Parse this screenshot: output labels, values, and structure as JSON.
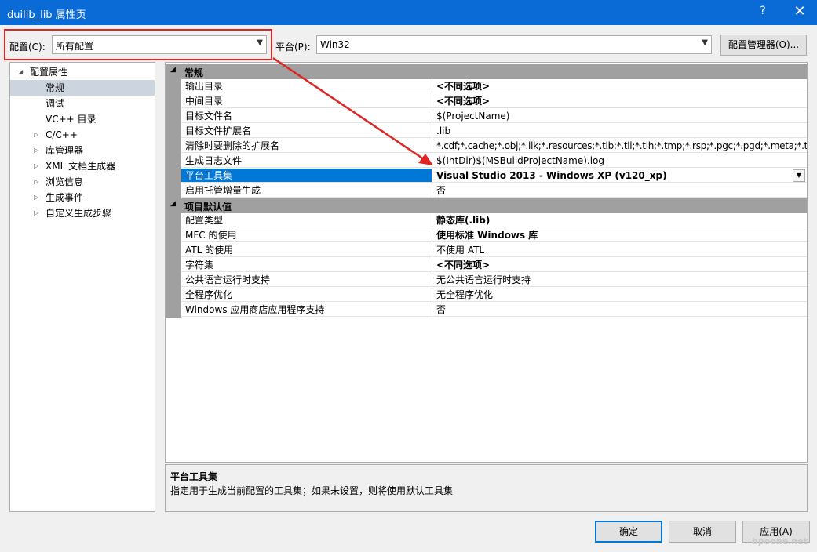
{
  "window": {
    "title": "duilib_lib 属性页",
    "help": "?",
    "close": "✕"
  },
  "config_bar": {
    "config_label": "配置(C):",
    "config_value": "所有配置",
    "platform_label": "平台(P):",
    "platform_value": "Win32",
    "manager_button": "配置管理器(O)..."
  },
  "tree": {
    "root": "配置属性",
    "items": [
      {
        "label": "常规",
        "selected": true
      },
      {
        "label": "调试"
      },
      {
        "label": "VC++ 目录"
      },
      {
        "label": "C/C++",
        "expandable": true
      },
      {
        "label": "库管理器",
        "expandable": true
      },
      {
        "label": "XML 文档生成器",
        "expandable": true
      },
      {
        "label": "浏览信息",
        "expandable": true
      },
      {
        "label": "生成事件",
        "expandable": true
      },
      {
        "label": "自定义生成步骤",
        "expandable": true
      }
    ]
  },
  "grid": {
    "cat1": "常规",
    "general": [
      {
        "name": "输出目录",
        "value": "<不同选项>"
      },
      {
        "name": "中间目录",
        "value": "<不同选项>"
      },
      {
        "name": "目标文件名",
        "value": "$(ProjectName)"
      },
      {
        "name": "目标文件扩展名",
        "value": ".lib"
      },
      {
        "name": "清除时要删除的扩展名",
        "value": "*.cdf;*.cache;*.obj;*.ilk;*.resources;*.tlb;*.tli;*.tlh;*.tmp;*.rsp;*.pgc;*.pgd;*.meta;*.tlog;"
      },
      {
        "name": "生成日志文件",
        "value": "$(IntDir)$(MSBuildProjectName).log"
      },
      {
        "name": "平台工具集",
        "value": "Visual Studio 2013 - Windows XP (v120_xp)"
      },
      {
        "name": "启用托管增量生成",
        "value": "否"
      }
    ],
    "cat2": "项目默认值",
    "defaults": [
      {
        "name": "配置类型",
        "value": "静态库(.lib)"
      },
      {
        "name": "MFC 的使用",
        "value": "使用标准 Windows 库"
      },
      {
        "name": "ATL 的使用",
        "value": "不使用 ATL"
      },
      {
        "name": "字符集",
        "value": "<不同选项>"
      },
      {
        "name": "公共语言运行时支持",
        "value": "无公共语言运行时支持"
      },
      {
        "name": "全程序优化",
        "value": "无全程序优化"
      },
      {
        "name": "Windows 应用商店应用程序支持",
        "value": "否"
      }
    ]
  },
  "description": {
    "title": "平台工具集",
    "text": "指定用于生成当前配置的工具集；如果未设置，则将使用默认工具集"
  },
  "buttons": {
    "ok": "确定",
    "cancel": "取消",
    "apply": "应用(A)"
  },
  "watermark": "bpoone.net",
  "colors": {
    "accent": "#0a6ad6",
    "annotation": "#e02424",
    "category_bar": "#a0a0a0",
    "selection": "#0078d7"
  }
}
